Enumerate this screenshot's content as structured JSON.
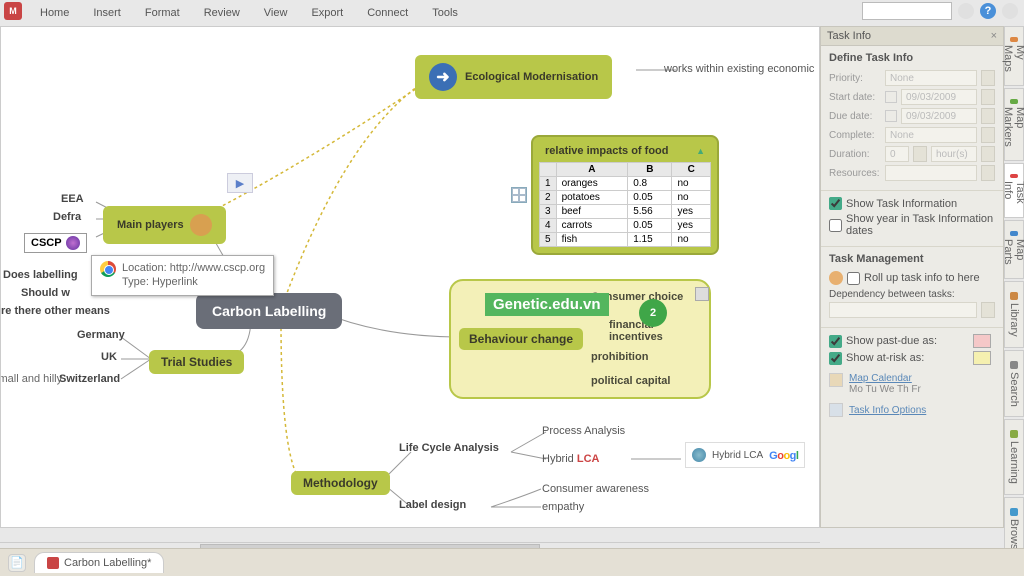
{
  "menu": [
    "Home",
    "Insert",
    "Format",
    "Review",
    "View",
    "Export",
    "Connect",
    "Tools"
  ],
  "ecological": "Ecological Modernisation",
  "ecological_note": "works within existing economic",
  "impacts": {
    "title": "relative impacts of food",
    "cols": [
      "",
      "A",
      "B",
      "C"
    ],
    "rows": [
      [
        "1",
        "oranges",
        "0.8",
        "no"
      ],
      [
        "2",
        "potatoes",
        "0.05",
        "no"
      ],
      [
        "3",
        "beef",
        "5.56",
        "yes"
      ],
      [
        "4",
        "carrots",
        "0.05",
        "yes"
      ],
      [
        "5",
        "fish",
        "1.15",
        "no"
      ]
    ]
  },
  "main_players": "Main players",
  "players": {
    "eea": "EEA",
    "defra": "Defra",
    "cscp": "CSCP"
  },
  "tooltip": {
    "loc": "Location: http://www.cscp.org",
    "type": "Type: Hyperlink"
  },
  "questions": {
    "q1": "Does labelling",
    "q2": "Should w",
    "q3": "re there other means"
  },
  "central": "Carbon Labelling",
  "behaviour": {
    "title": "Behaviour change",
    "items": {
      "consumer": "Consumer choice",
      "financial": "financial incentives",
      "prohibition": "prohibition",
      "political": "political capital"
    }
  },
  "brand_overlay": "Genetic.edu.vn",
  "trial": {
    "title": "Trial Studies",
    "c1": "Germany",
    "c2": "UK",
    "c3": "Switzerland",
    "note": "small and hilly"
  },
  "methodology": "Methodology",
  "lifecycle": {
    "title": "Life Cycle Analysis",
    "p1": "Process Analysis",
    "p2": "Hybrid LCA",
    "link": "Hybrid LCA"
  },
  "labeldesign": {
    "title": "Label design",
    "i1": "Consumer awareness",
    "i2": "empathy"
  },
  "google": "Goog",
  "taskinfo": {
    "panel_title": "Task Info",
    "h1": "Define Task Info",
    "priority": {
      "l": "Priority:",
      "v": "None"
    },
    "start": {
      "l": "Start date:",
      "v": "09/03/2009"
    },
    "due": {
      "l": "Due date:",
      "v": "09/03/2009"
    },
    "complete": {
      "l": "Complete:",
      "v": "None"
    },
    "duration": {
      "l": "Duration:",
      "v": "0",
      "unit": "hour(s)"
    },
    "resources": {
      "l": "Resources:"
    },
    "show_ti": "Show Task Information",
    "show_year": "Show year in Task Information dates",
    "h2": "Task Management",
    "rollup": "Roll up task info to here",
    "dep": "Dependency between tasks:",
    "pastdue": "Show past-due as:",
    "atrisk": "Show at-risk as:",
    "mapcal": "Map Calendar",
    "days": "Mo Tu We Th Fr",
    "opts": "Task Info Options"
  },
  "rtabs": [
    "My Maps",
    "Map Markers",
    "Task Info",
    "Map Parts",
    "Library",
    "Search",
    "Learning",
    "Browser"
  ],
  "bottom_tab": "Carbon Labelling*"
}
